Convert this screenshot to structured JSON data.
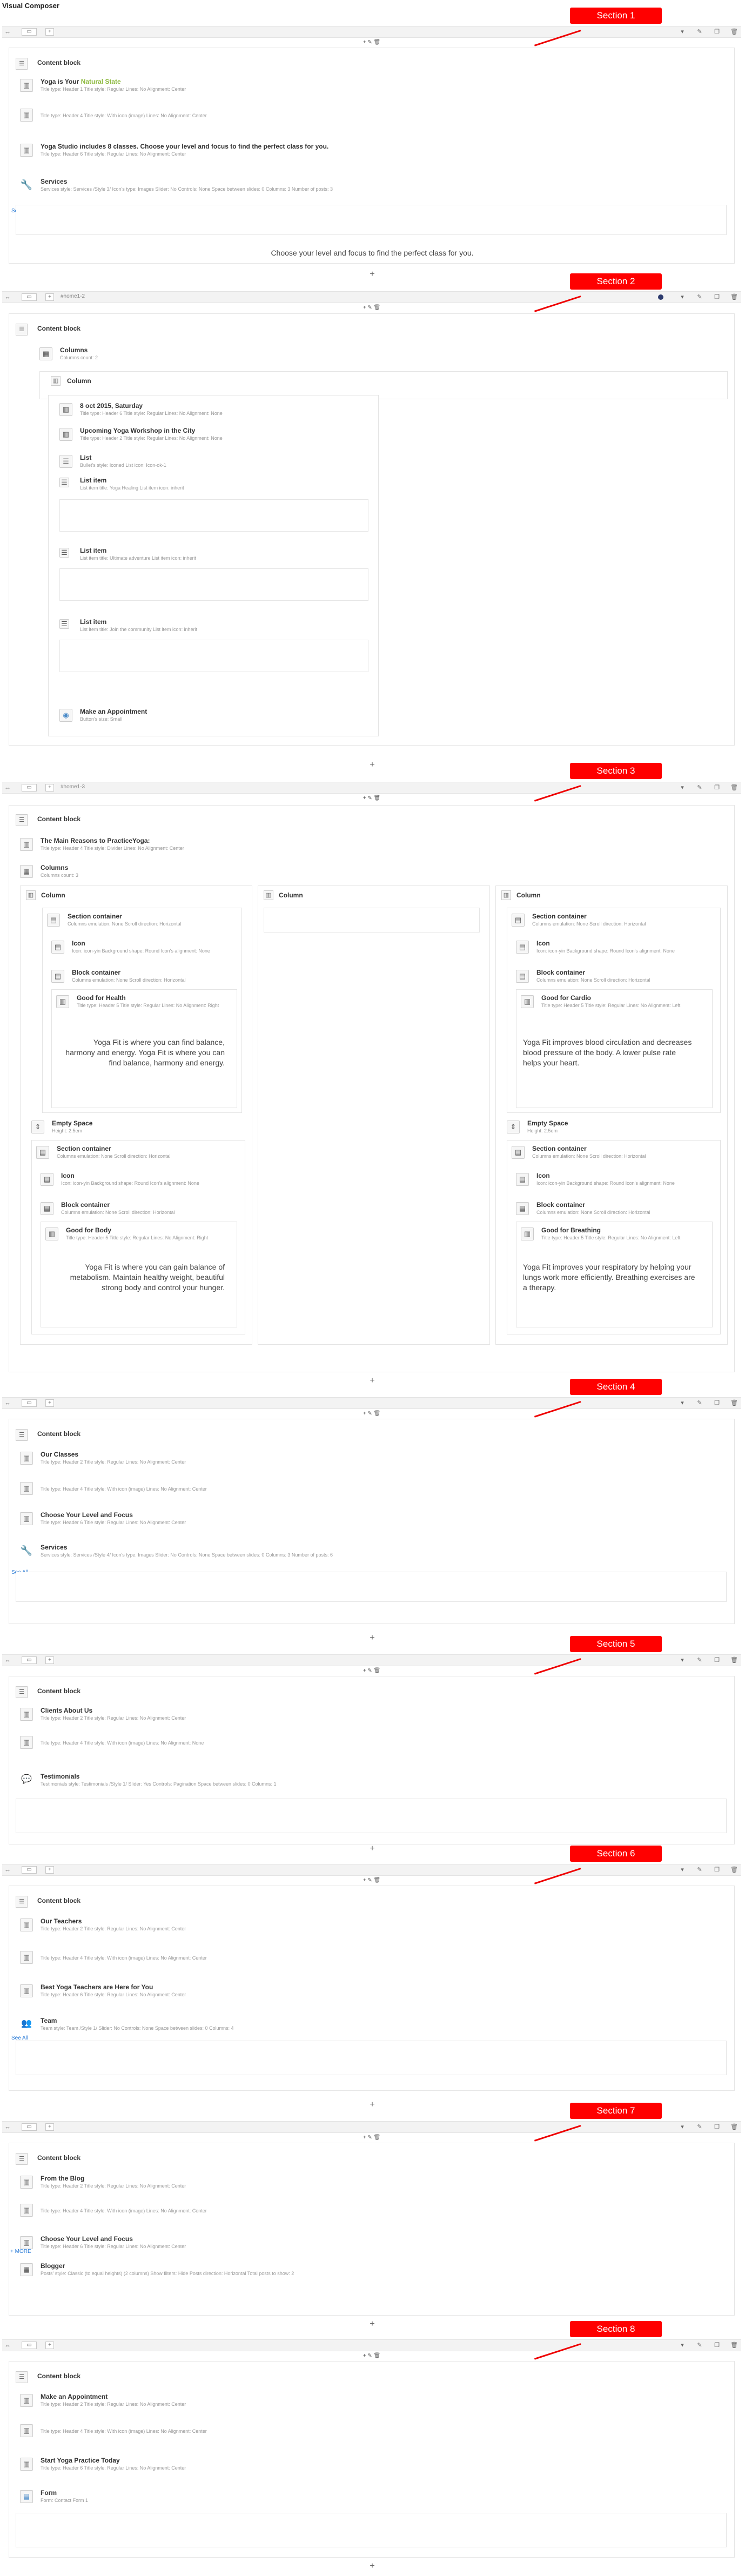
{
  "app": {
    "title": "Visual Composer"
  },
  "toolbar": {
    "move": "⇔",
    "row": "▭",
    "add": "+",
    "dropdown": "▾",
    "edit": "✎",
    "clone": "❐",
    "delete": "🗑"
  },
  "colors": {
    "section_tag": "#ff0000",
    "accent": "#8bb83c",
    "link": "#2a7bd6",
    "dot": "#2d3b6e"
  },
  "sections": [
    {
      "tag": "Section 1",
      "id": ""
    },
    {
      "tag": "Section 2",
      "id": "#home1-2"
    },
    {
      "tag": "Section 3",
      "id": "#home1-3"
    },
    {
      "tag": "Section 4",
      "id": ""
    },
    {
      "tag": "Section 5",
      "id": ""
    },
    {
      "tag": "Section 6",
      "id": ""
    },
    {
      "tag": "Section 7",
      "id": ""
    },
    {
      "tag": "Section 8",
      "id": ""
    }
  ],
  "common": {
    "content_block": "Content block",
    "see_all": "See All",
    "plus": "+",
    "columns": "Columns",
    "column": "Column"
  },
  "s1": {
    "el1_name": "Yoga is Your",
    "el1_accent": "Natural State",
    "el1_desc": "Title type: Header 1  Title style: Regular  Lines: No  Alignment: Center",
    "el2_desc": "Title type: Header 4  Title style: With icon (image)  Lines: No  Alignment: Center",
    "el3_name": "Yoga Studio includes 8 classes. Choose your level and focus to find the perfect class for you.",
    "el3_desc": "Title type: Header 6  Title style: Regular  Lines: No  Alignment: Center",
    "el4_name": "Services",
    "el4_desc": "Services style: Services /Style 3/  Icon's type: Images  Slider: No  Controls: None  Space between slides: 0  Columns: 3  Number of posts: 3",
    "text": "Choose your level and focus to find the perfect class for you."
  },
  "s2": {
    "cols_desc": "Columns count: 2",
    "el1_name": "8 oct 2015, Saturday",
    "el1_desc": "Title type: Header 6  Title style: Regular  Lines: No  Alignment: None",
    "el2_name": "Upcoming Yoga Workshop in the City",
    "el2_desc": "Title type: Header 2  Title style: Regular  Lines: No  Alignment: None",
    "el3_name": "List",
    "el3_desc": "Bullet's style: Iconed  List icon: Icon-ok-1",
    "li_name": "List item",
    "li1_desc": "List item title: Yoga Healing  List item icon: inherit",
    "li2_desc": "List item title: Ultimate adventure  List item icon: inherit",
    "li3_desc": "List item title: Join the community  List item icon: inherit",
    "el4_name": "Make an Appointment",
    "el4_desc": "Button's size: Small"
  },
  "s3": {
    "el1_name": "The Main Reasons to PracticeYoga:",
    "el1_desc": "Title type: Header 4  Title style: Divider  Lines: No  Alignment: Center",
    "cols_desc": "Columns count: 3",
    "section_container": "Section container",
    "sc_desc": "Columns emulation: None  Scroll direction: Horizontal",
    "icon": "Icon",
    "icon_desc": "Icon: icon-yin  Background shape: Round  Icon's alignment: None",
    "block_container": "Block container",
    "bc_desc": "Columns emulation: None  Scroll direction: Horizontal",
    "health_name": "Good for Health",
    "health_desc": "Title type: Header 5  Title style: Regular  Lines: No  Alignment: Right",
    "health_text": "Yoga Fit is where you can find balance, harmony and energy. Yoga Fit is where you can find balance, harmony and energy.",
    "cardio_name": "Good for Cardio",
    "cardio_desc": "Title type: Header 5  Title style: Regular  Lines: No  Alignment: Left",
    "cardio_text": "Yoga Fit improves blood circulation and decreases blood pressure of the body. A lower pulse rate helps your heart.",
    "space_name": "Empty Space",
    "space_desc": "Height: 2.5em",
    "body_name": "Good for Body",
    "body_desc": "Title type: Header 5  Title style: Regular  Lines: No  Alignment: Right",
    "body_text": "Yoga Fit is where you can gain balance of metabolism. Maintain healthy weight, beautiful strong body and control your hunger.",
    "breath_name": "Good for Breathing",
    "breath_desc": "Title type: Header 5  Title style: Regular  Lines: No  Alignment: Left",
    "breath_text": "Yoga Fit improves your respiratory by helping your lungs work more efficiently. Breathing exercises are a therapy."
  },
  "s4": {
    "el1_name": "Our Classes",
    "el1_desc": "Title type: Header 2  Title style: Regular  Lines: No  Alignment: Center",
    "el2_desc": "Title type: Header 4  Title style: With icon (image)  Lines: No  Alignment: Center",
    "el3_name": "Choose Your Level and Focus",
    "el3_desc": "Title type: Header 6  Title style: Regular  Lines: No  Alignment: Center",
    "el4_name": "Services",
    "el4_desc": "Services style: Services /Style 4/  Icon's type: Images  Slider: No  Controls: None  Space between slides: 0  Columns: 3  Number of posts: 6"
  },
  "s5": {
    "el1_name": "Clients About Us",
    "el1_desc": "Title type: Header 2  Title style: Regular  Lines: No  Alignment: Center",
    "el2_desc": "Title type: Header 4  Title style: With icon (image)  Lines: No  Alignment: None",
    "el3_name": "Testimonials",
    "el3_desc": "Testimonials style: Testimonials /Style 1/  Slider: Yes  Controls: Pagination  Space between slides: 0  Columns: 1"
  },
  "s6": {
    "el1_name": "Our Teachers",
    "el1_desc": "Title type: Header 2  Title style: Regular  Lines: No  Alignment: Center",
    "el2_desc": "Title type: Header 4  Title style: With icon (image)  Lines: No  Alignment: Center",
    "el3_name": "Best Yoga Teachers are Here for You",
    "el3_desc": "Title type: Header 6  Title style: Regular  Lines: No  Alignment: Center",
    "el4_name": "Team",
    "el4_desc": "Team style: Team /Style 1/  Slider: No  Controls: None  Space between slides: 0  Columns: 4"
  },
  "s7": {
    "el1_name": "From the Blog",
    "el1_desc": "Title type: Header 2  Title style: Regular  Lines: No  Alignment: Center",
    "el2_desc": "Title type: Header 4  Title style: With icon (image)  Lines: No  Alignment: Center",
    "el3_name": "Choose Your Level and Focus",
    "el3_desc": "Title type: Header 6  Title style: Regular  Lines: No  Alignment: Center",
    "more": "+ MORE",
    "el4_name": "Blogger",
    "el4_desc": "Posts' style: Classic (to equal heights) (2 columns)  Show filters: Hide  Posts direction: Horizontal  Total posts to show: 2"
  },
  "s8": {
    "el1_name": "Make an Appointment",
    "el1_desc": "Title type: Header 2  Title style: Regular  Lines: No  Alignment: Center",
    "el2_desc": "Title type: Header 4  Title style: With icon (image)  Lines: No  Alignment: Center",
    "el3_name": "Start Yoga Practice Today",
    "el3_desc": "Title type: Header 6  Title style: Regular  Lines: No  Alignment: Center",
    "el4_name": "Form",
    "el4_desc": "Form: Contact Form 1"
  }
}
